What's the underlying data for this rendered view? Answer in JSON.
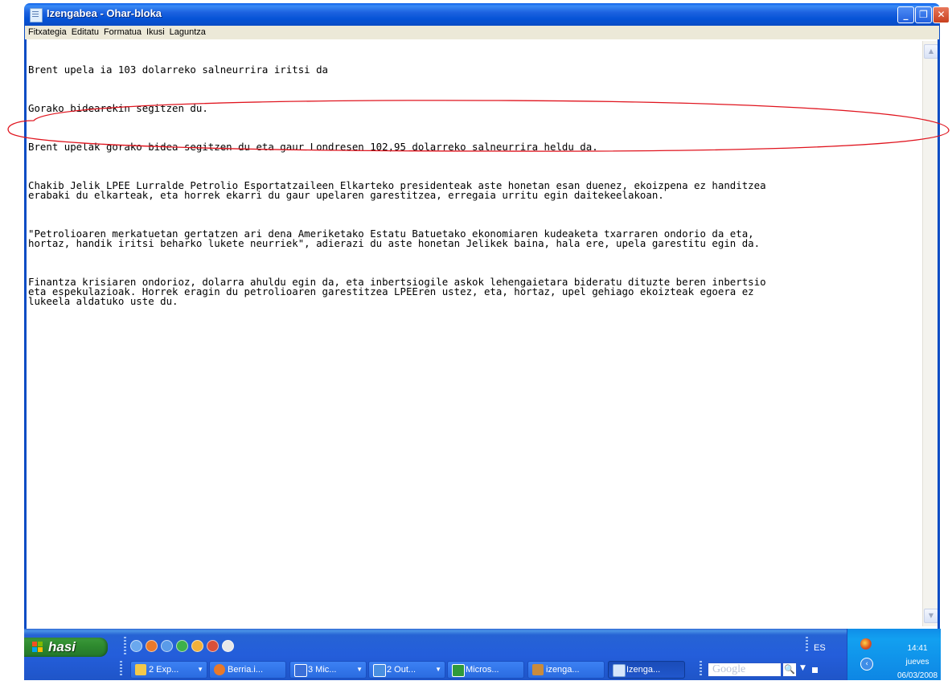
{
  "window": {
    "title": "Izengabea - Ohar-bloka",
    "buttons": {
      "minimize": "_",
      "maximize": "❐",
      "close": "✕"
    }
  },
  "menu": [
    "Fitxategia",
    "Editatu",
    "Formatua",
    "Ikusi",
    "Laguntza"
  ],
  "document": {
    "paragraphs": [
      "Brent upela ia 103 dolarreko salneurrira iritsi da",
      "Gorako bidearekin segitzen du.",
      "Brent upelak gorako bidea segitzen du eta gaur Londresen 102,95 dolarreko salneurrira heldu da.",
      "Chakib Jelik LPEE Lurralde Petrolio Esportatzaileen Elkarteko presidenteak aste honetan esan duenez, ekoizpena ez handitzea\nerabaki du elkarteak, eta horrek ekarri du gaur upelaren garestitzea, erregaia urritu egin daitekeelakoan.",
      "\"Petrolioaren merkatuetan gertatzen ari dena Ameriketako Estatu Batuetako ekonomiaren kudeaketa txarraren ondorio da eta,\nhortaz, handik iritsi beharko lukete neurriek\", adierazi du aste honetan Jelikek baina, hala ere, upela garestitu egin da.",
      "Finantza krisiaren ondorioz, dolarra ahuldu egin da, eta inbertsiogile askok lehengaietara bideratu dituzte beren inbertsio\neta espekulazioak. Horrek eragin du petrolioaren garestitzea LPEEren ustez, eta, hortaz, upel gehiago ekoizteak egoera ez\nlukeela aldatuko uste du."
    ],
    "annotation_color": "#e0141e"
  },
  "taskbar": {
    "start_label": "hasi",
    "tasks": [
      {
        "label": "2 Exp...",
        "icon_color": "#f2c84b"
      },
      {
        "label": "Berria.i...",
        "icon_color": "#e8792a"
      },
      {
        "label": "3 Mic...",
        "icon_color": "#3a6fd8"
      },
      {
        "label": "2 Out...",
        "icon_color": "#4a8fe0"
      },
      {
        "label": "Micros...",
        "icon_color": "#2f9a3c"
      },
      {
        "label": "izenga...",
        "icon_color": "#c98b3c"
      },
      {
        "label": "Izenga...",
        "icon_color": "#d6e6fb"
      }
    ],
    "google_text": "Google",
    "language": "ES",
    "clock": {
      "time": "14:41",
      "day": "jueves",
      "date": "06/03/2008"
    }
  }
}
